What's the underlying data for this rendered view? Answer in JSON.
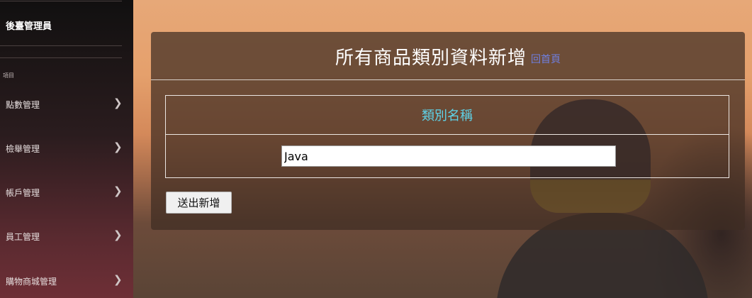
{
  "sidebar": {
    "user": "後臺管理員",
    "section_label": "項目",
    "items": [
      {
        "label": "點數管理"
      },
      {
        "label": "檢舉管理"
      },
      {
        "label": "帳戶管理"
      },
      {
        "label": "員工管理"
      },
      {
        "label": "購物商城管理"
      }
    ]
  },
  "panel": {
    "title": "所有商品類別資料新增",
    "home_link": "回首頁",
    "field_header": "類別名稱",
    "field_value": "Java",
    "submit_label": "送出新增"
  },
  "icons": {
    "chevron": "chevron-right-icon"
  },
  "colors": {
    "field_header": "#5ed3e8",
    "home_link": "#6f7fe0"
  }
}
